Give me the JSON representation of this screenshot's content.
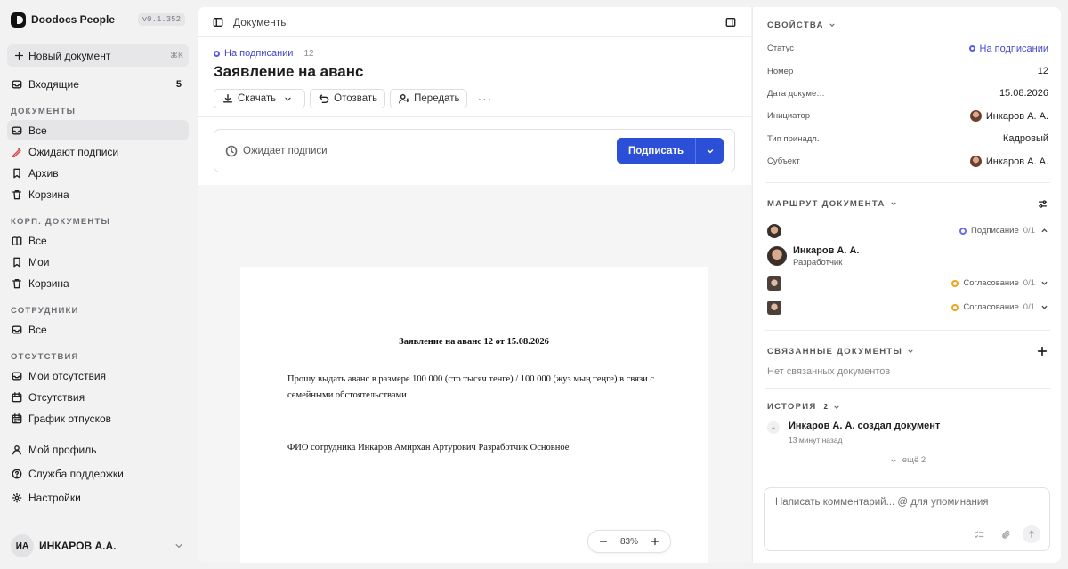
{
  "sidebar": {
    "brand": "Doodocs People",
    "version": "v0.1.352",
    "new_doc": "Новый документ",
    "new_doc_shortcut": "⌘K",
    "inbox": {
      "label": "Входящие",
      "count": "5"
    },
    "sections": [
      {
        "title": "Документы",
        "items": [
          "Все",
          "Ожидают подписи",
          "Архив",
          "Корзина"
        ]
      },
      {
        "title": "Корп. документы",
        "items": [
          "Все",
          "Мои",
          "Корзина"
        ]
      },
      {
        "title": "Сотрудники",
        "items": [
          "Все"
        ]
      },
      {
        "title": "Отсутствия",
        "items": [
          "Мои отсутствия",
          "Отсутствия",
          "График отпусков"
        ]
      }
    ],
    "bottom": [
      "Мой профиль",
      "Служба поддержки",
      "Настройки"
    ],
    "user": {
      "initials": "ИА",
      "name": "ИНКАРОВ А.А."
    }
  },
  "main": {
    "breadcrumb": "Документы",
    "status": "На подписании",
    "number": "12",
    "title": "Заявление на аванс",
    "actions": {
      "download": "Скачать",
      "revoke": "Отозвать",
      "transfer": "Передать",
      "more": "···"
    },
    "sign_card": {
      "waiting": "Ожидает подписи",
      "sign_button": "Подписать"
    },
    "paper": {
      "title": "Заявление на аванс 12 от 15.08.2026",
      "body": "Прошу выдать аванс в размере 100 000 (сто тысяч тенге) / 100 000 (жуз мың теңге) в связи с семейными обстоятельствами",
      "fio": "ФИО сотрудника Инкаров Амирхан Артурович Разработчик Основное"
    },
    "zoom": "83%"
  },
  "panel": {
    "properties": {
      "title": "Свойства",
      "rows": [
        {
          "k": "Статус",
          "v": "На подписании"
        },
        {
          "k": "Номер",
          "v": "12"
        },
        {
          "k": "Дата докуме…",
          "v": "15.08.2026"
        },
        {
          "k": "Инициатор",
          "v": "Инкаров А. А."
        },
        {
          "k": "Тип принадл.",
          "v": "Кадровый"
        },
        {
          "k": "Субъект",
          "v": "Инкаров А. А."
        }
      ]
    },
    "route": {
      "title": "Маршрут документа",
      "steps": [
        {
          "label": "Подписание",
          "count": "0/1"
        },
        {
          "label": "Согласование",
          "count": "0/1"
        },
        {
          "label": "Согласование",
          "count": "0/1"
        }
      ],
      "signer": {
        "name": "Инкаров А. А.",
        "role": "Разработчик"
      }
    },
    "related": {
      "title": "Связанные документы",
      "empty": "Нет связанных документов"
    },
    "history": {
      "title": "История",
      "count": "2",
      "item": {
        "text": "Инкаров А. А. создал документ",
        "time": "13 минут назад"
      },
      "more": "ещё 2"
    },
    "comment_placeholder": "Написать комментарий... @ для упоминания"
  }
}
